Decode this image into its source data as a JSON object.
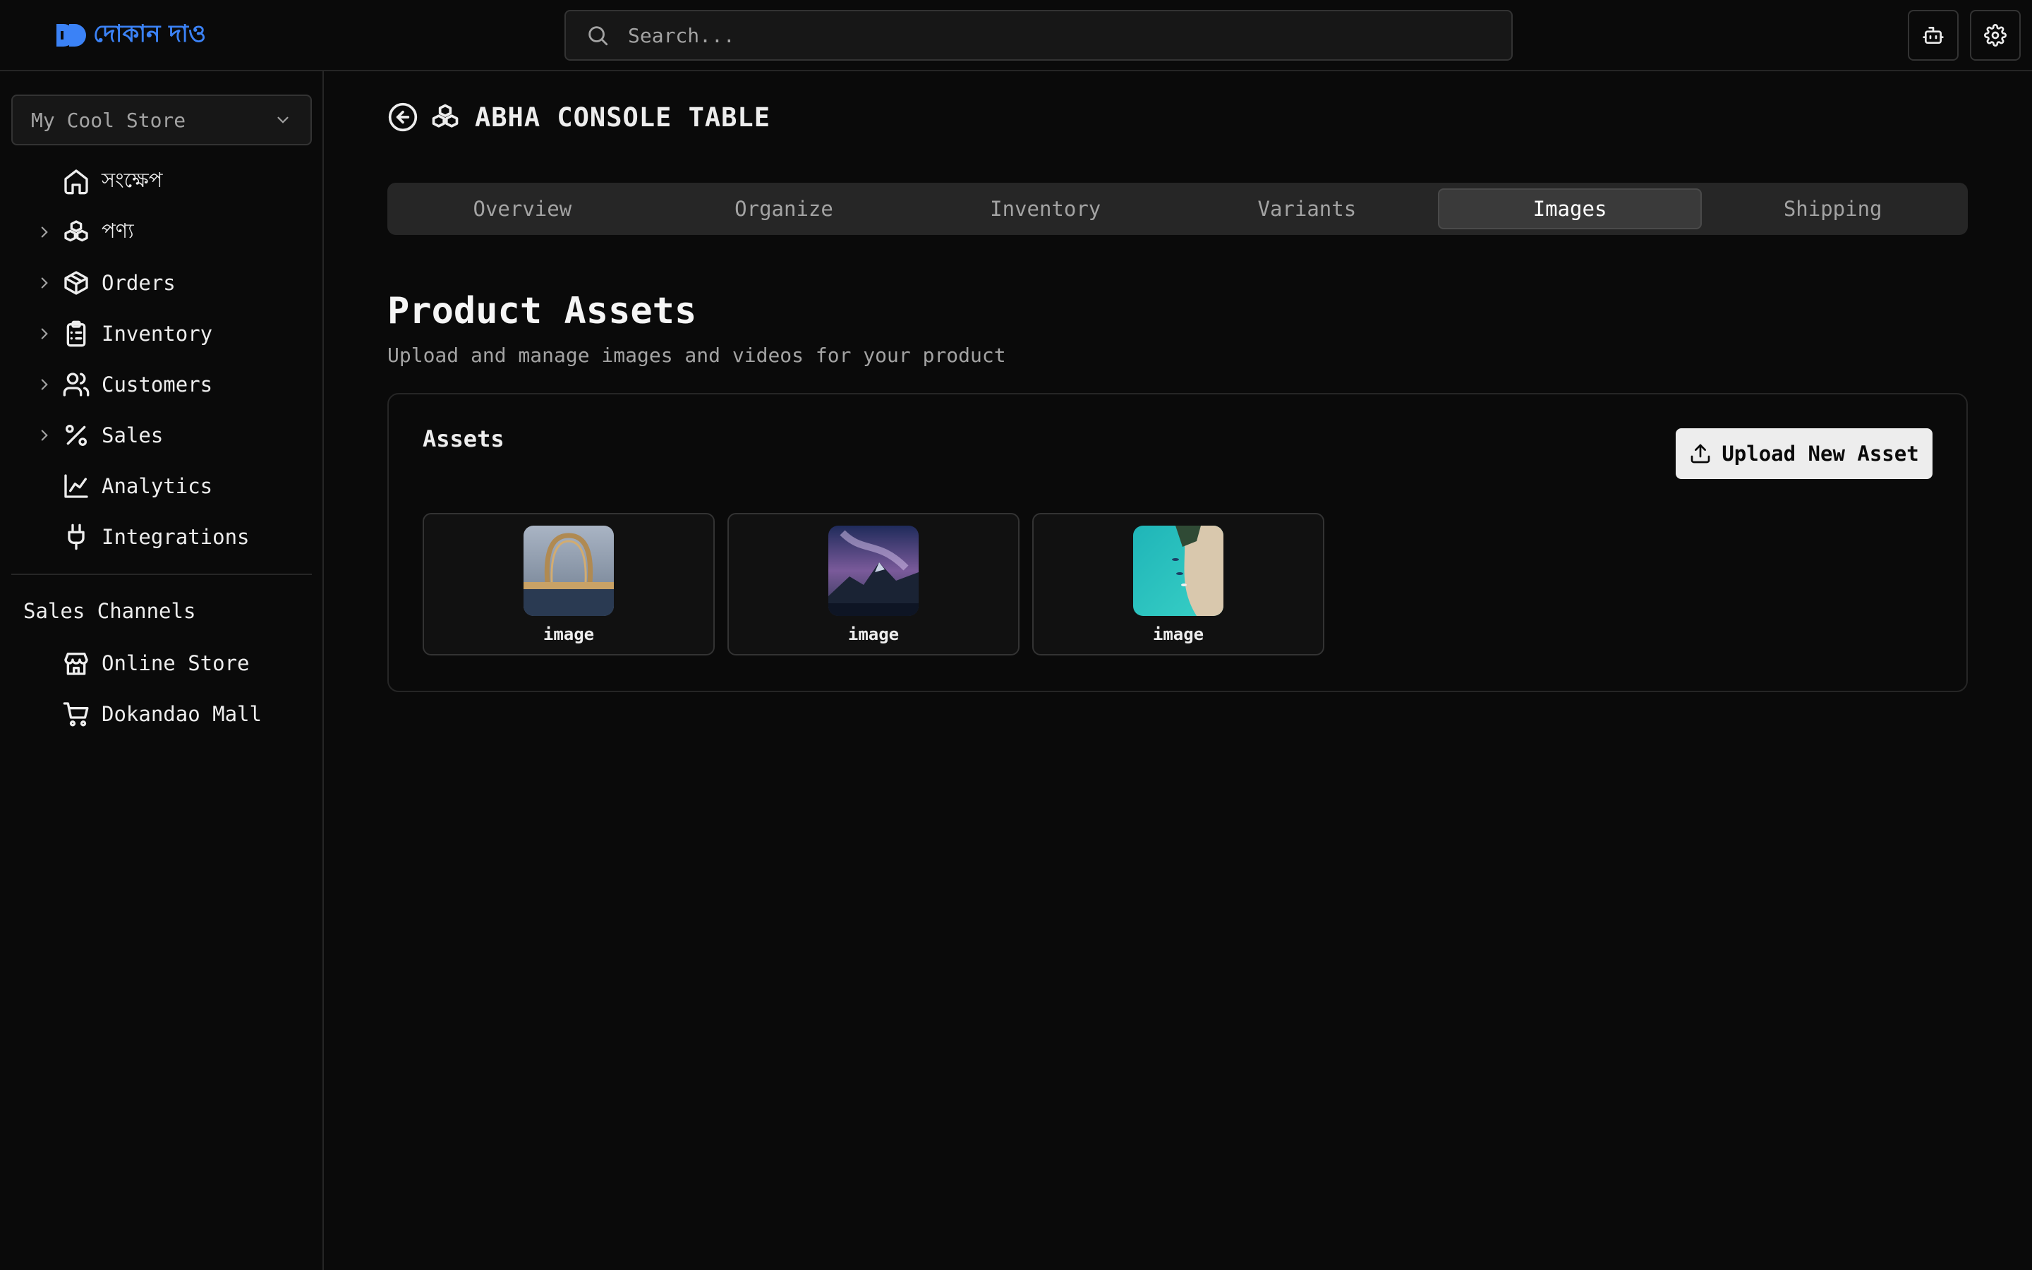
{
  "app": {
    "brand_name": "দোকান দাও",
    "brand_color": "#3b82f6"
  },
  "header": {
    "search_placeholder": "Search...",
    "bot_icon": "bot-icon",
    "settings_icon": "gear-icon"
  },
  "sidebar": {
    "store_selector": "My Cool Store",
    "items": [
      {
        "label": "সংক্ষেপ",
        "icon": "home-icon",
        "expandable": false
      },
      {
        "label": "পণ্য",
        "icon": "boxes-icon",
        "expandable": true
      },
      {
        "label": "Orders",
        "icon": "package-icon",
        "expandable": true
      },
      {
        "label": "Inventory",
        "icon": "clipboard-list-icon",
        "expandable": true
      },
      {
        "label": "Customers",
        "icon": "users-icon",
        "expandable": true
      },
      {
        "label": "Sales",
        "icon": "percent-icon",
        "expandable": true
      },
      {
        "label": "Analytics",
        "icon": "line-chart-icon",
        "expandable": false
      },
      {
        "label": "Integrations",
        "icon": "plug-icon",
        "expandable": false
      }
    ],
    "sales_channels_title": "Sales Channels",
    "channels": [
      {
        "label": "Online Store",
        "icon": "store-icon"
      },
      {
        "label": "Dokandao Mall",
        "icon": "shopping-cart-icon"
      }
    ]
  },
  "product": {
    "title": "ABHA CONSOLE TABLE"
  },
  "tabs": [
    {
      "label": "Overview",
      "active": false
    },
    {
      "label": "Organize",
      "active": false
    },
    {
      "label": "Inventory",
      "active": false
    },
    {
      "label": "Variants",
      "active": false
    },
    {
      "label": "Images",
      "active": true
    },
    {
      "label": "Shipping",
      "active": false
    }
  ],
  "page": {
    "heading": "Product Assets",
    "subheading": "Upload and manage images and videos for your product"
  },
  "assets_card": {
    "title": "Assets",
    "upload_label": "Upload New Asset",
    "items": [
      {
        "label": "image"
      },
      {
        "label": "image"
      },
      {
        "label": "image"
      }
    ]
  }
}
